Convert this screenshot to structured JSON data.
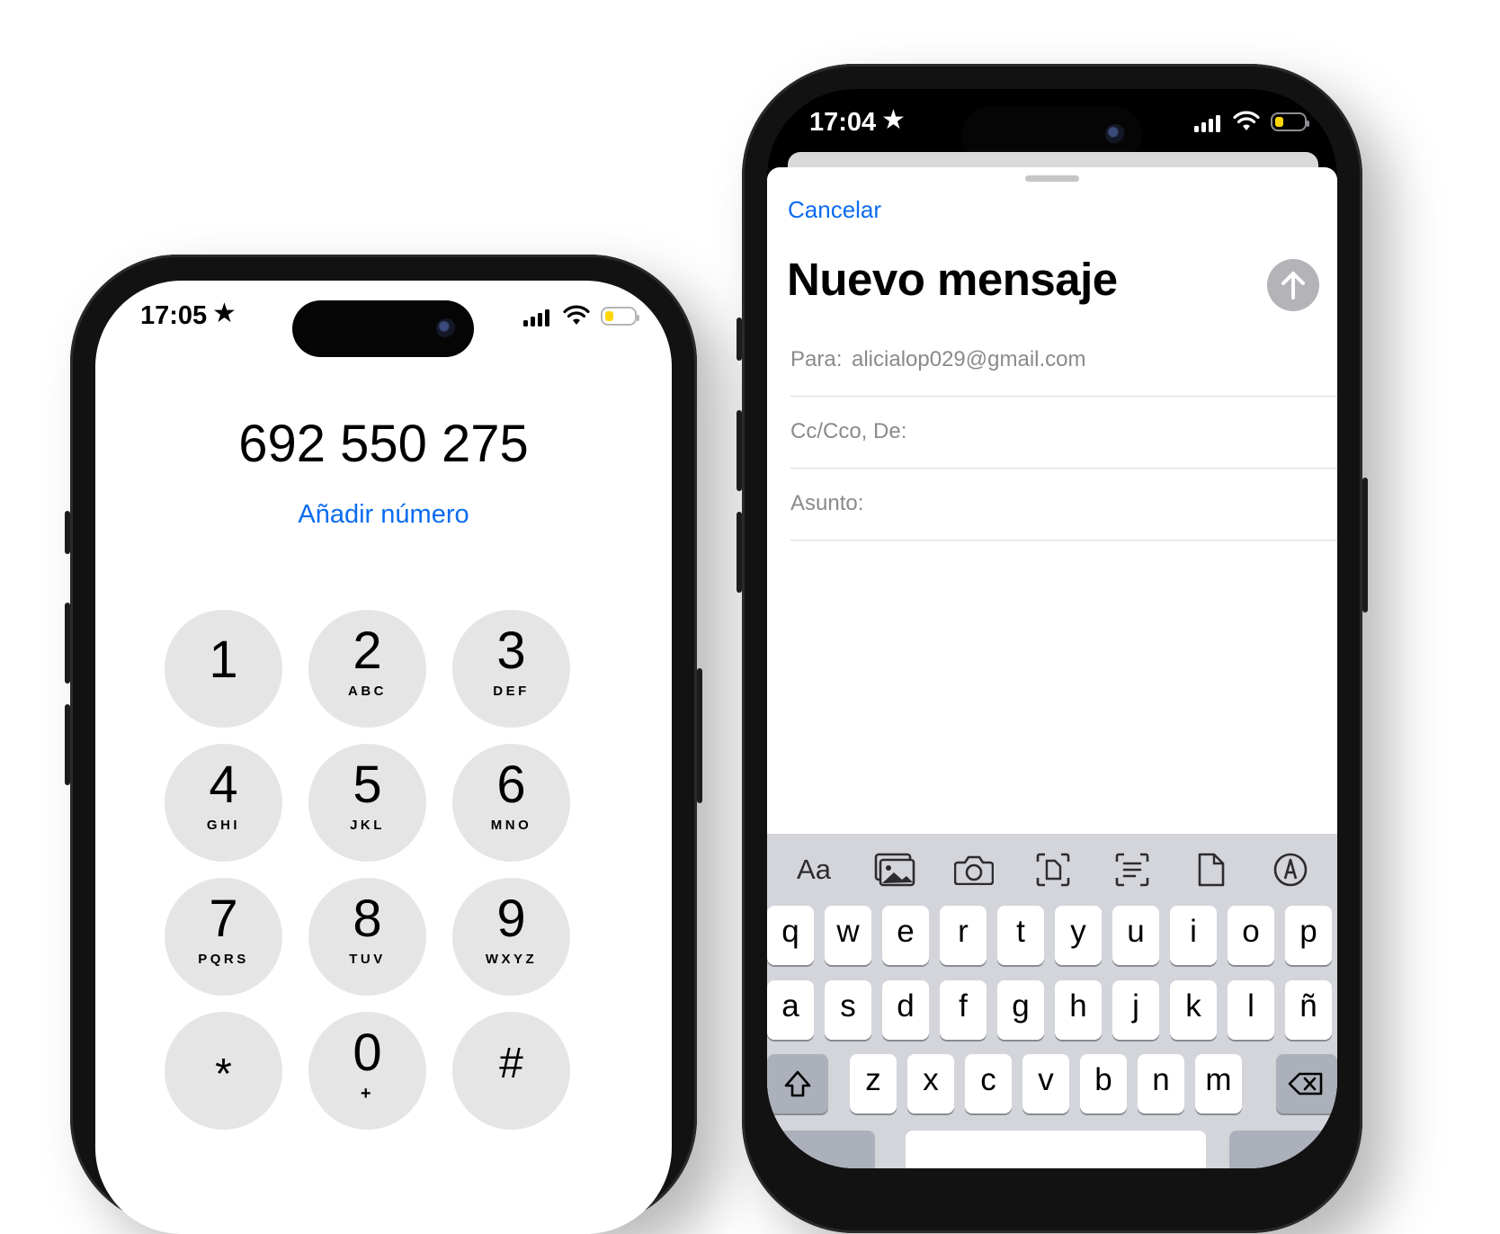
{
  "dialer": {
    "status_time": "17:05",
    "star_icon": "★",
    "number": "692 550 275",
    "add_number_label": "Añadir número",
    "keys": [
      {
        "digit": "1",
        "letters": ""
      },
      {
        "digit": "2",
        "letters": "ABC"
      },
      {
        "digit": "3",
        "letters": "DEF"
      },
      {
        "digit": "4",
        "letters": "GHI"
      },
      {
        "digit": "5",
        "letters": "JKL"
      },
      {
        "digit": "6",
        "letters": "MNO"
      },
      {
        "digit": "7",
        "letters": "PQRS"
      },
      {
        "digit": "8",
        "letters": "TUV"
      },
      {
        "digit": "9",
        "letters": "WXYZ"
      },
      {
        "digit": "*",
        "letters": ""
      },
      {
        "digit": "0",
        "letters": "+"
      },
      {
        "digit": "#",
        "letters": ""
      }
    ]
  },
  "mail": {
    "status_time": "17:04",
    "star_icon": "★",
    "cancel_label": "Cancelar",
    "title": "Nuevo mensaje",
    "to_label": "Para:",
    "to_value": "alicialop029@gmail.com",
    "cc_label": "Cc/Cco, De:",
    "subject_label": "Asunto:",
    "toolbar": {
      "format_label": "Aa",
      "icons": [
        "photo-library-icon",
        "camera-icon",
        "scan-document-icon",
        "scan-text-icon",
        "attach-file-icon",
        "markup-icon"
      ]
    },
    "keyboard": {
      "row1": [
        "q",
        "w",
        "e",
        "r",
        "t",
        "y",
        "u",
        "i",
        "o",
        "p"
      ],
      "row2": [
        "a",
        "s",
        "d",
        "f",
        "g",
        "h",
        "j",
        "k",
        "l",
        "ñ"
      ],
      "row3": [
        "z",
        "x",
        "c",
        "v",
        "b",
        "n",
        "m"
      ]
    }
  },
  "colors": {
    "accent_blue": "#0a6cf0",
    "key_gray": "#e5e5e5",
    "send_disabled": "#b4b4b8",
    "battery_low": "#ffd60a",
    "keyboard_bg": "#d3d5db"
  }
}
